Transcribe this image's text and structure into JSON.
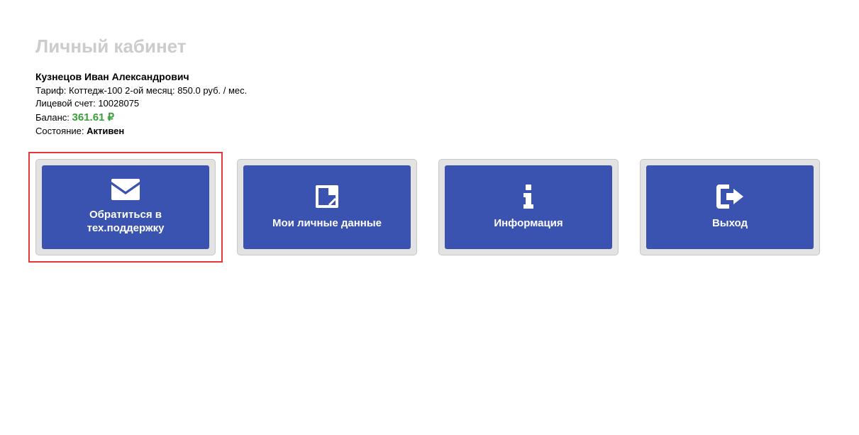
{
  "page_title": "Личный кабинет",
  "user": {
    "name": "Кузнецов Иван Александрович",
    "tariff_label": "Тариф:",
    "tariff_value": "Коттедж-100 2-ой месяц: 850.0 руб. / мес.",
    "account_label": "Лицевой счет:",
    "account_value": "10028075",
    "balance_label": "Баланс:",
    "balance_value": "361.61 ₽",
    "status_label": "Состояние:",
    "status_value": "Активен"
  },
  "cards": {
    "support": {
      "label": "Обратиться в\nтех.поддержку",
      "icon": "envelope-icon"
    },
    "personal": {
      "label": "Мои личные данные",
      "icon": "note-icon"
    },
    "info": {
      "label": "Информация",
      "icon": "info-icon"
    },
    "exit": {
      "label": "Выход",
      "icon": "signout-icon"
    }
  },
  "colors": {
    "accent": "#3a52b0",
    "balance": "#3a9e3a",
    "highlight_border": "#e53935"
  }
}
